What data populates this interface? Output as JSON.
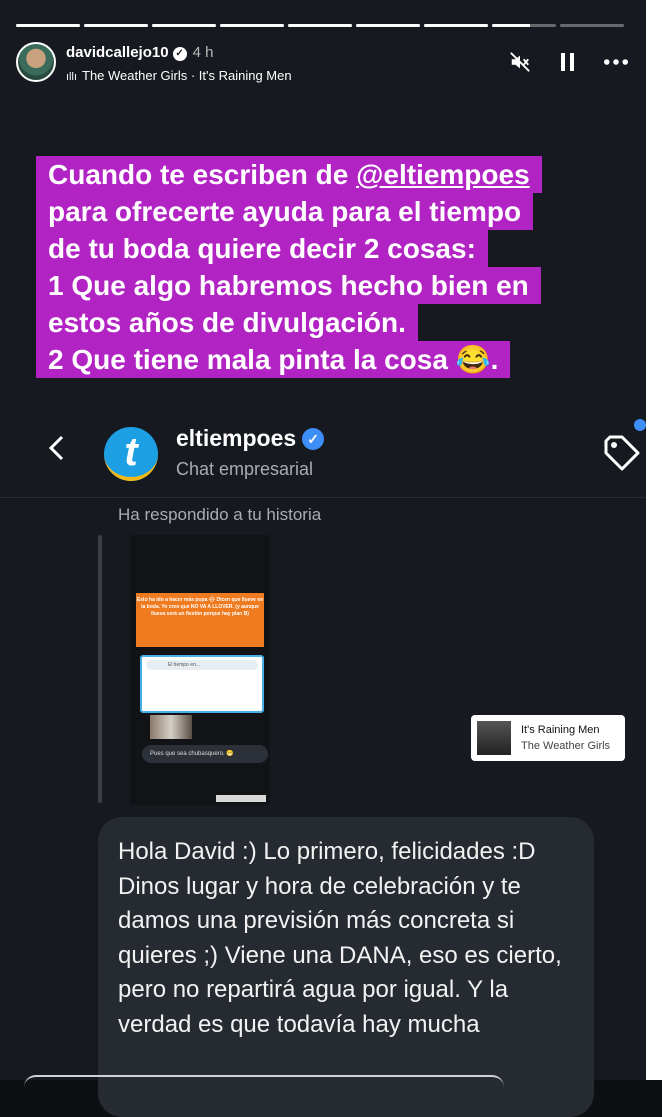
{
  "story": {
    "progress": [
      1,
      1,
      1,
      1,
      1,
      1,
      1,
      0.6,
      0
    ],
    "username": "davidcallejo10",
    "time": "4 h",
    "song": "The Weather Girls · It's Raining Men",
    "icons": [
      "mute-icon",
      "pause-icon",
      "more-icon"
    ]
  },
  "caption": {
    "lines": [
      {
        "pre": "Cuando te escriben de ",
        "mention": "@eltiempoes",
        "post": ""
      },
      {
        "pre": "para ofrecerte ayuda para el tiempo",
        "mention": "",
        "post": ""
      },
      {
        "pre": "de tu boda quiere decir 2 cosas:",
        "mention": "",
        "post": ""
      },
      {
        "pre": "1 Que algo habremos hecho bien en",
        "mention": "",
        "post": ""
      },
      {
        "pre": "estos años de divulgación.",
        "mention": "",
        "post": ""
      },
      {
        "pre": "2 Que tiene mala pinta la cosa 😂.",
        "mention": "",
        "post": ""
      }
    ],
    "highlight_color": "#b223c4"
  },
  "chat": {
    "name": "eltiempoes",
    "subtitle": "Chat empresarial",
    "replied_label": "Ha respondido a tu historia",
    "thumbnail": {
      "orange_text": "Esto ha ido a hacer más pupa 🌧 Dicen que llueve en la boda. Yo creo que NO VA A LLOVER. (y aunque llueva será un fiestón porque hay plan B)",
      "search_text": "El tiempo en...",
      "reply_text": "Pues que sea chubasquero. 😁"
    },
    "song_sticker": {
      "title": "It's Raining Men",
      "artist": "The Weather Girls"
    },
    "message": "Hola David :) Lo primero, felicidades :D Dinos lugar y hora de celebración y te damos una previsión más concreta si quieres ;) Viene una DANA, eso es cierto, pero no repartirá agua por igual. Y la verdad es que todavía hay mucha"
  }
}
